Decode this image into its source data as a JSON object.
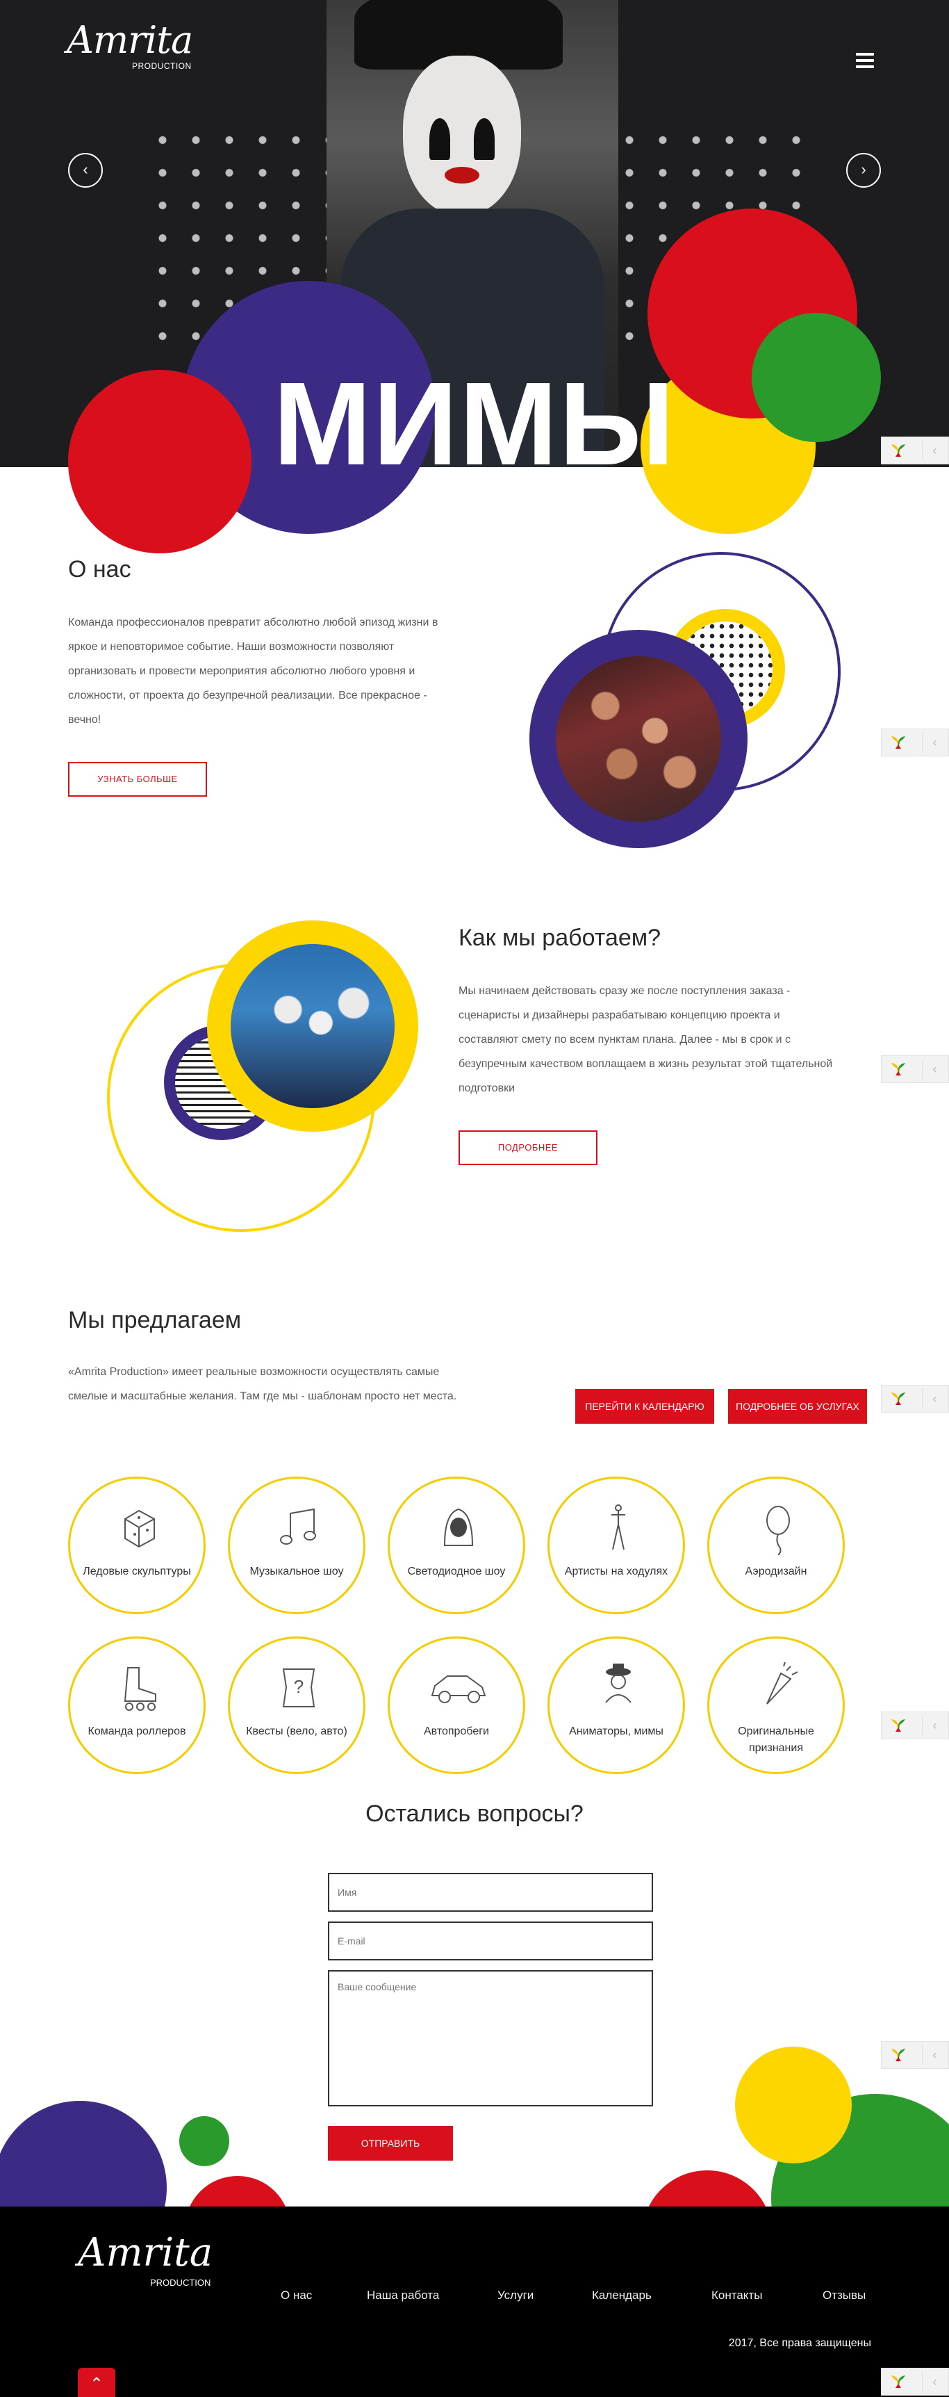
{
  "hero": {
    "title": "МИМЫ",
    "prev_arrow": "‹",
    "next_arrow": "›"
  },
  "logo": {
    "brand": "Amrita",
    "sub": "PRODUCTION"
  },
  "about": {
    "title": "О нас",
    "text": "Команда профессионалов превратит абсолютно любой эпизод жизни в яркое и неповторимое событие. Наши возможности позволяют организовать и провести мероприятия абсолютно любого уровня и сложности, от проекта до безупречной реализации. Все прекрасное - вечно!",
    "button": "УЗНАТЬ БОЛЬШЕ"
  },
  "how": {
    "title": "Как мы работаем?",
    "text": "Мы начинаем действовать сразу же после поступления заказа - сценаристы и дизайнеры разрабатываю концепцию проекта и составляют смету по всем пунктам плана. Далее - мы в срок и с безупречным качеством воплащаем в жизнь результат этой тщательной подготовки",
    "button": "ПОДРОБНЕЕ"
  },
  "offer": {
    "title": "Мы предлагаем",
    "text": "«Amrita Production» имеет реальные возможности осуществлять самые смелые и масштабные желания. Там где мы - шаблонам просто нет места.",
    "btn_calendar": "ПЕРЕЙТИ К КАЛЕНДАРЮ",
    "btn_services": "ПОДРОБНЕЕ ОБ УСЛУГАХ",
    "services": [
      {
        "label": "Ледовые скульптуры",
        "icon": "ice-cube-icon"
      },
      {
        "label": "Музыкальное шоу",
        "icon": "music-note-icon"
      },
      {
        "label": "Светодиодное шоу",
        "icon": "led-hood-icon"
      },
      {
        "label": "Артисты на ходулях",
        "icon": "stilts-icon"
      },
      {
        "label": "Аэродизайн",
        "icon": "balloon-icon"
      },
      {
        "label": "Команда роллеров",
        "icon": "roller-skate-icon"
      },
      {
        "label": "Квесты (вело, авто)",
        "icon": "quest-map-icon"
      },
      {
        "label": "Автопробеги",
        "icon": "car-icon"
      },
      {
        "label": "Аниматоры, мимы",
        "icon": "mime-icon"
      },
      {
        "label": "Оригинальные признания",
        "icon": "confetti-icon"
      }
    ]
  },
  "contact": {
    "title": "Остались вопросы?",
    "name_placeholder": "Имя",
    "email_placeholder": "E-mail",
    "message_placeholder": "Ваше сообщение",
    "submit": "ОТПРАВИТЬ"
  },
  "footer": {
    "nav": [
      "О нас",
      "Наша работа",
      "Услуги",
      "Календарь",
      "Контакты",
      "Отзывы"
    ],
    "copyright": "2017, Все права защищены",
    "to_top": "⌃"
  },
  "colors": {
    "red": "#d9101b",
    "purple": "#3d2a85",
    "yellow": "#fdd600",
    "green": "#2a9a2c",
    "dark": "#1d1d1f"
  }
}
